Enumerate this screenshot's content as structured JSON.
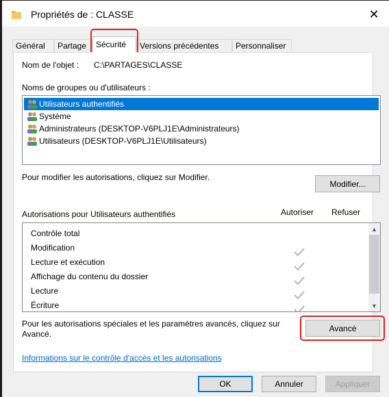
{
  "window": {
    "title": "Propriétés de : CLASSE",
    "close_glyph": "✕"
  },
  "tabs": [
    {
      "label": "Général"
    },
    {
      "label": "Partage"
    },
    {
      "label": "Sécurité"
    },
    {
      "label": "Versions précédentes"
    },
    {
      "label": "Personnaliser"
    }
  ],
  "security": {
    "object_name_label": "Nom de l'objet :",
    "object_name_value": "C:\\PARTAGES\\CLASSE",
    "groups_label": "Noms de groupes ou d'utilisateurs :",
    "groups": [
      {
        "label": "Utilisateurs authentifiés",
        "selected": true
      },
      {
        "label": "Système",
        "selected": false
      },
      {
        "label": "Administrateurs (DESKTOP-V6PLJ1E\\Administrateurs)",
        "selected": false
      },
      {
        "label": "Utilisateurs (DESKTOP-V6PLJ1E\\Utilisateurs)",
        "selected": false
      }
    ],
    "modify_hint": "Pour modifier les autorisations, cliquez sur Modifier.",
    "modify_button": "Modifier...",
    "permissions_for": "Autorisations pour Utilisateurs authentifiés",
    "allow_header": "Autoriser",
    "deny_header": "Refuser",
    "permissions": [
      {
        "label": "Contrôle total",
        "allow": false
      },
      {
        "label": "Modification",
        "allow": true
      },
      {
        "label": "Lecture et exécution",
        "allow": true
      },
      {
        "label": "Affichage du contenu du dossier",
        "allow": true
      },
      {
        "label": "Lecture",
        "allow": true
      },
      {
        "label": "Écriture",
        "allow": true
      }
    ],
    "advanced_hint_line1": "Pour les autorisations spéciales et les paramètres avancés, cliquez sur",
    "advanced_hint_line2": "Avancé.",
    "advanced_button": "Avancé",
    "info_link": "Informations sur le contrôle d'accès et les autorisations"
  },
  "footer": {
    "ok": "OK",
    "cancel": "Annuler",
    "apply": "Appliquer"
  },
  "colors": {
    "selection": "#0078d7",
    "highlight": "#e02020",
    "link": "#0066cc"
  }
}
